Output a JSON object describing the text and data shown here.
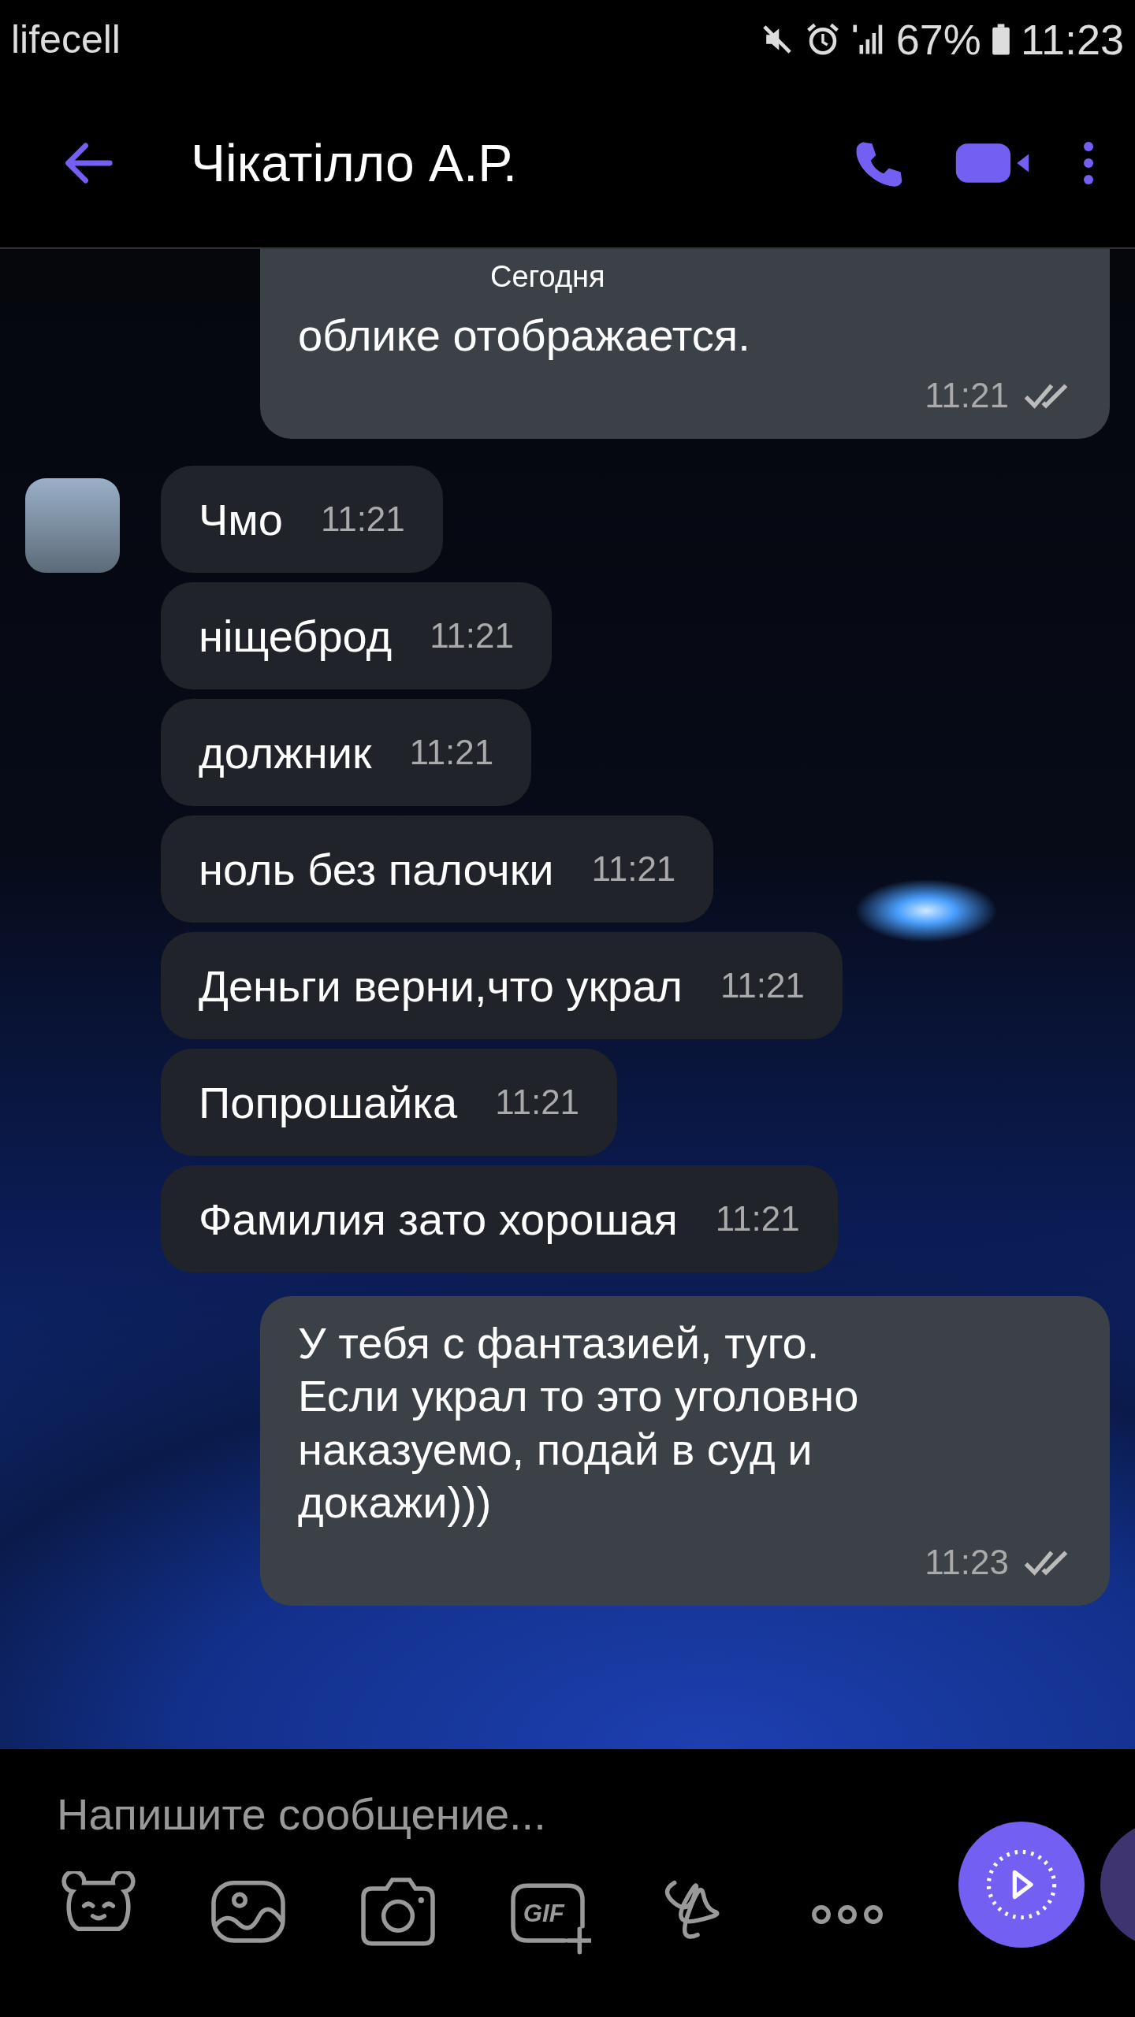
{
  "status_bar": {
    "carrier": "lifecell",
    "battery": "67%",
    "time": "11:23"
  },
  "header": {
    "title": "Чікатілло А.Р."
  },
  "date_label": "Сегодня",
  "messages": [
    {
      "kind": "outgoing",
      "lines": [
        "облике отображается."
      ],
      "time": "11:21",
      "seen": true
    },
    {
      "kind": "incoming",
      "text": "Чмо",
      "time": "11:21"
    },
    {
      "kind": "incoming",
      "text": "ніщеброд",
      "time": "11:21"
    },
    {
      "kind": "incoming",
      "text": "должник",
      "time": "11:21"
    },
    {
      "kind": "incoming",
      "text": "ноль без палочки",
      "time": "11:21"
    },
    {
      "kind": "incoming",
      "text": "Деньги верни,что украл",
      "time": "11:21"
    },
    {
      "kind": "incoming",
      "text": "Попрошайка",
      "time": "11:21"
    },
    {
      "kind": "incoming",
      "text": "Фамилия зато хорошая",
      "time": "11:21"
    },
    {
      "kind": "outgoing",
      "lines": [
        "У тебя с фантазией, туго.",
        "Если украл то это уголовно",
        "наказуемо,  подай в суд и",
        "докажи)))"
      ],
      "time": "11:23",
      "seen": true
    }
  ],
  "composer": {
    "placeholder": "Напишите сообщение...",
    "gif_label": "GIF"
  }
}
